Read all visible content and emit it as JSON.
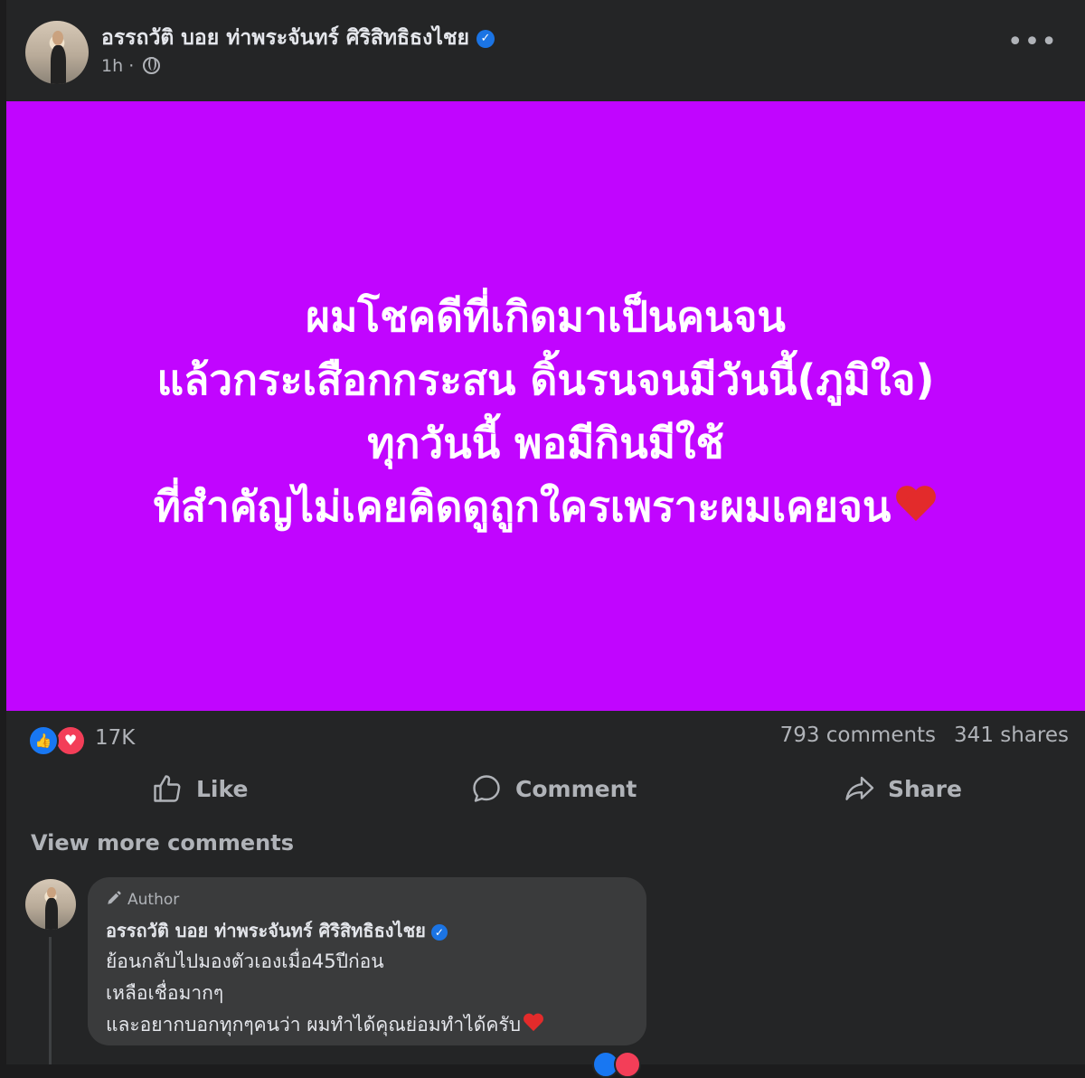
{
  "post": {
    "author": "อรรถวัติ บอย ท่าพระจันทร์ ศิริสิทธิธงไชย",
    "time": "1h",
    "separator": "·",
    "more_label": "•••",
    "background_color": "#c105ff",
    "text_lines": [
      "ผมโชคดีที่เกิดมาเป็นคนจน",
      "แล้วกระเสือกกระสน ดิ้นรนจนมีวันนี้(ภูมิใจ)",
      "ทุกวันนี้ พอมีกินมีใช้",
      "ที่สำคัญไม่เคยคิดดูถูกใครเพราะผมเคยจน"
    ]
  },
  "stats": {
    "reaction_count": "17K",
    "comments": "793 comments",
    "shares": "341 shares"
  },
  "actions": {
    "like": "Like",
    "comment": "Comment",
    "share": "Share"
  },
  "comments": {
    "view_more": "View more comments",
    "items": [
      {
        "badge": "Author",
        "name": "อรรถวัติ บอย ท่าพระจันทร์ ศิริสิทธิธงไชย",
        "lines": [
          "ย้อนกลับไปมองตัวเองเมื่อ45ปีก่อน",
          "เหลือเชื่อมากๆ",
          "และอยากบอกทุกๆคนว่า ผมทำได้คุณย่อมทำได้ครับ"
        ]
      }
    ]
  },
  "colors": {
    "like_blue": "#1877f2",
    "love_red": "#f33e58",
    "verified_blue": "#1b74e4"
  }
}
